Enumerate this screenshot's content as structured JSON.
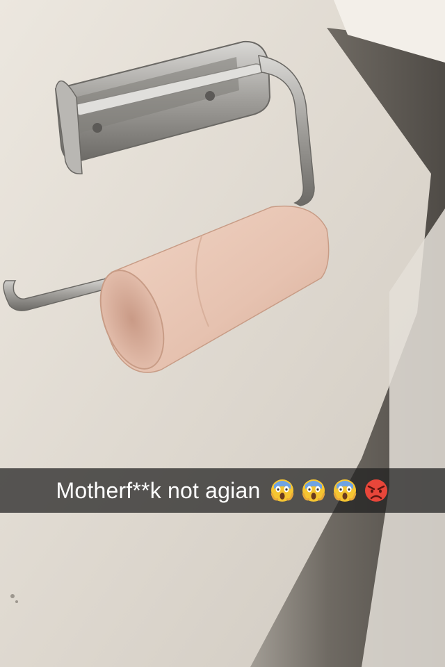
{
  "caption": {
    "text": "Motherf**k not agian",
    "emojis": [
      "face-screaming-in-fear-icon",
      "face-screaming-in-fear-icon",
      "face-screaming-in-fear-icon",
      "angry-face-icon"
    ]
  },
  "colors": {
    "wall": "#e6e0d7",
    "shadow_wall": "#6d6862",
    "metal": "#a9a7a3",
    "cardboard": "#e7c4b2",
    "caption_bar": "#1e1e1e"
  }
}
